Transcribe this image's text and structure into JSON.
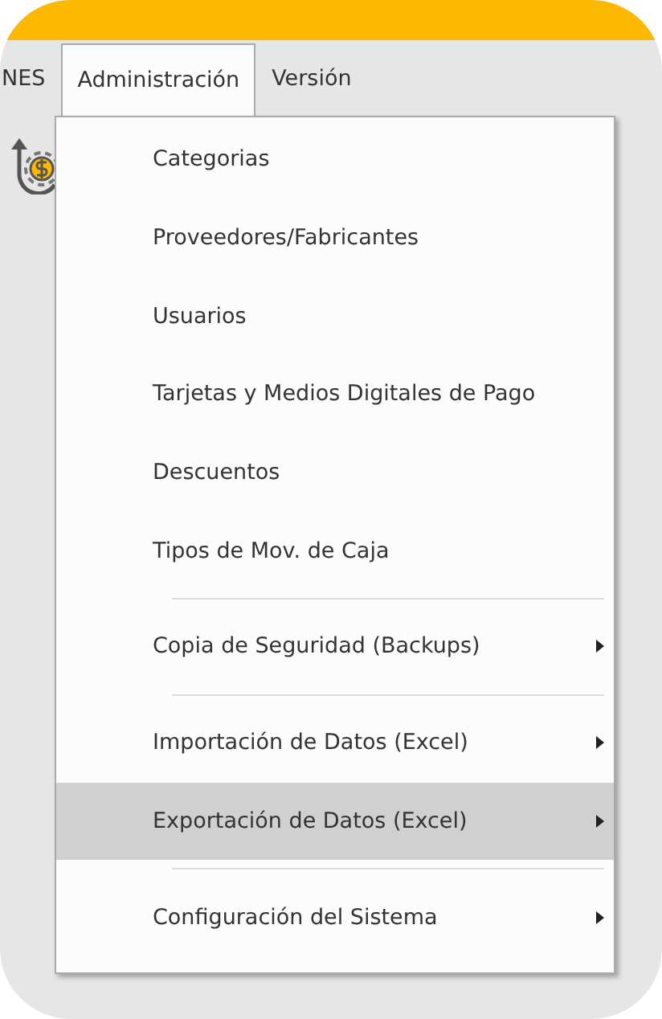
{
  "menu_bar": [
    {
      "label": "NES",
      "selected": false
    },
    {
      "label": "Administración",
      "selected": true
    },
    {
      "label": "Versión",
      "selected": false
    }
  ],
  "menu": [
    {
      "kind": "item",
      "label": "Categorias",
      "submenu": false,
      "selected": false
    },
    {
      "kind": "item",
      "label": "Proveedores/Fabricantes",
      "submenu": false,
      "selected": false
    },
    {
      "kind": "item",
      "label": "Usuarios",
      "submenu": false,
      "selected": false
    },
    {
      "kind": "item",
      "label": "Tarjetas y Medios Digitales de Pago",
      "submenu": false,
      "selected": false
    },
    {
      "kind": "item",
      "label": "Descuentos",
      "submenu": false,
      "selected": false
    },
    {
      "kind": "item",
      "label": "Tipos de Mov. de Caja",
      "submenu": false,
      "selected": false
    },
    {
      "kind": "separator"
    },
    {
      "kind": "item",
      "label": "Copia de Seguridad (Backups)",
      "submenu": true,
      "selected": false
    },
    {
      "kind": "separator"
    },
    {
      "kind": "item",
      "label": "Importación de Datos (Excel)",
      "submenu": true,
      "selected": false
    },
    {
      "kind": "item",
      "label": "Exportación de Datos (Excel)",
      "submenu": true,
      "selected": true
    },
    {
      "kind": "separator"
    },
    {
      "kind": "item",
      "label": "Configuración del Sistema",
      "submenu": true,
      "selected": false
    }
  ]
}
